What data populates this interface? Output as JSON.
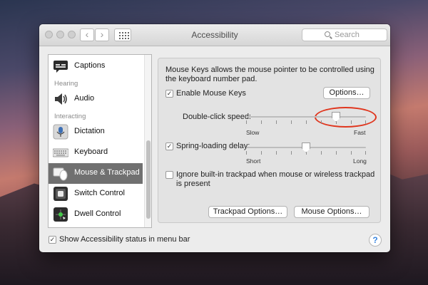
{
  "window": {
    "title": "Accessibility",
    "search_placeholder": "Search",
    "nav_back": "‹",
    "nav_forward": "›"
  },
  "sidebar": {
    "items": [
      {
        "label": "Captions"
      },
      {
        "label": "Audio"
      },
      {
        "label": "Dictation"
      },
      {
        "label": "Keyboard"
      },
      {
        "label": "Mouse & Trackpad",
        "selected": true
      },
      {
        "label": "Switch Control"
      },
      {
        "label": "Dwell Control"
      }
    ],
    "categories": {
      "hearing": "Hearing",
      "interacting": "Interacting"
    }
  },
  "pane": {
    "description": "Mouse Keys allows the mouse pointer to be controlled using the keyboard number pad.",
    "enable_mouse_keys": {
      "label": "Enable Mouse Keys",
      "checked": true
    },
    "options_button": "Options…",
    "double_click": {
      "label": "Double-click speed:",
      "min_label": "Slow",
      "max_label": "Fast",
      "value": 0.75
    },
    "spring_loading": {
      "label": "Spring-loading delay:",
      "checked": true,
      "min_label": "Short",
      "max_label": "Long",
      "value": 0.5
    },
    "ignore_trackpad": {
      "label": "Ignore built-in trackpad when mouse or wireless trackpad is present",
      "checked": false
    },
    "trackpad_options_button": "Trackpad Options…",
    "mouse_options_button": "Mouse Options…"
  },
  "footer": {
    "show_status": {
      "label": "Show Accessibility status in menu bar",
      "checked": true
    },
    "help": "?"
  },
  "colors": {
    "selected_row": "#707070",
    "highlight_circle": "#e0361e",
    "help_accent": "#3a86e0"
  }
}
